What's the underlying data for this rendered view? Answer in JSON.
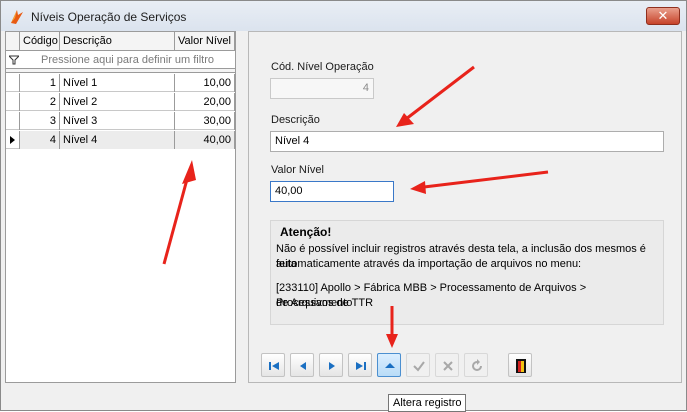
{
  "window": {
    "title": "Níveis Operação de Serviços",
    "close_label": "✕"
  },
  "grid": {
    "columns": [
      "Código",
      "Descrição",
      "Valor Nível"
    ],
    "filter_placeholder": "Pressione aqui para definir um filtro",
    "rows": [
      {
        "codigo": "1",
        "descricao": "Nível 1",
        "valor": "10,00"
      },
      {
        "codigo": "2",
        "descricao": "Nível 2",
        "valor": "20,00"
      },
      {
        "codigo": "3",
        "descricao": "Nível 3",
        "valor": "30,00"
      },
      {
        "codigo": "4",
        "descricao": "Nível 4",
        "valor": "40,00"
      }
    ],
    "selected_row": 3
  },
  "form": {
    "codigo_label": "Cód. Nível Operação",
    "codigo_value": "4",
    "descricao_label": "Descrição",
    "descricao_value": "Nível 4",
    "valor_label": "Valor Nível",
    "valor_value": "40,00"
  },
  "notice": {
    "title": "Atenção!",
    "line1": "Não é possível incluir registros através desta tela, a inclusão dos mesmos é feita",
    "line2": "automaticamente através da importação de arquivos no menu:",
    "line3": "[233110] Apollo > Fábrica MBB > Processamento de Arquivos > Processamento",
    "line4": "de Arquivos de TTR"
  },
  "navigator": {
    "buttons": [
      "first-icon",
      "prior-icon",
      "next-icon",
      "last-icon",
      "edit-icon",
      "post-icon",
      "cancel-icon",
      "refresh-icon"
    ],
    "exit_icon": "exit-door-icon"
  },
  "tooltip": "Altera registro",
  "colors": {
    "annotation_arrow": "#e8231b",
    "nav_blue": "#1a6fc2",
    "selection_row": "#ececec"
  }
}
